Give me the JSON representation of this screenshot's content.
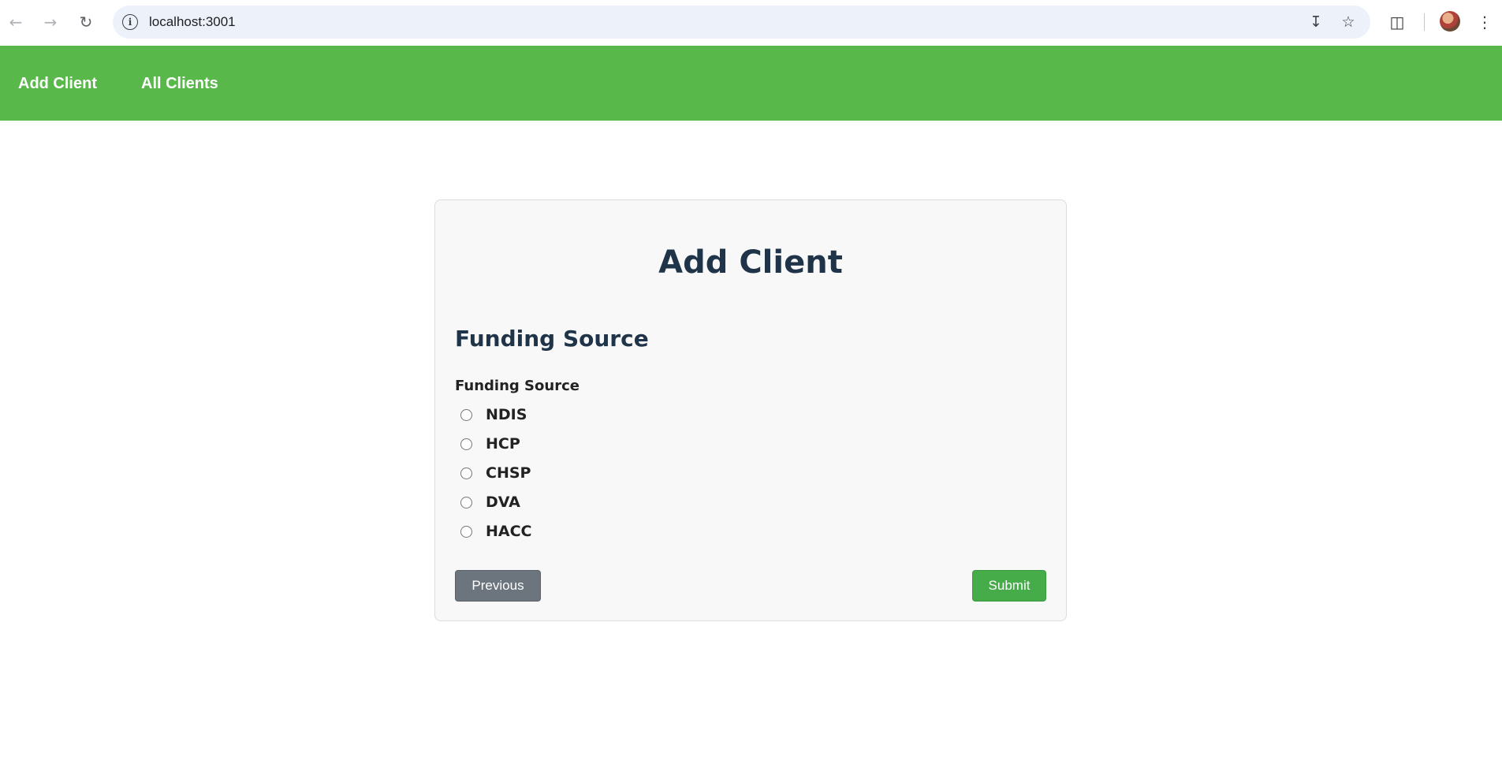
{
  "browser": {
    "url": "localhost:3001",
    "icons": [
      "back-arrow-icon",
      "forward-arrow-icon",
      "reload-icon",
      "site-info-icon",
      "install-app-icon",
      "bookmark-star-icon",
      "extensions-icon",
      "profile-avatar",
      "kebab-menu-icon"
    ]
  },
  "nav": {
    "links": [
      "Add Client",
      "All Clients"
    ],
    "bg_color": "#58b94a"
  },
  "form": {
    "title": "Add Client",
    "section_title": "Funding Source",
    "group_label": "Funding Source",
    "options": [
      "NDIS",
      "HCP",
      "CHSP",
      "DVA",
      "HACC"
    ],
    "prev_label": "Previous",
    "submit_label": "Submit",
    "submit_color": "#46ac4a",
    "prev_color": "#6c757d"
  }
}
